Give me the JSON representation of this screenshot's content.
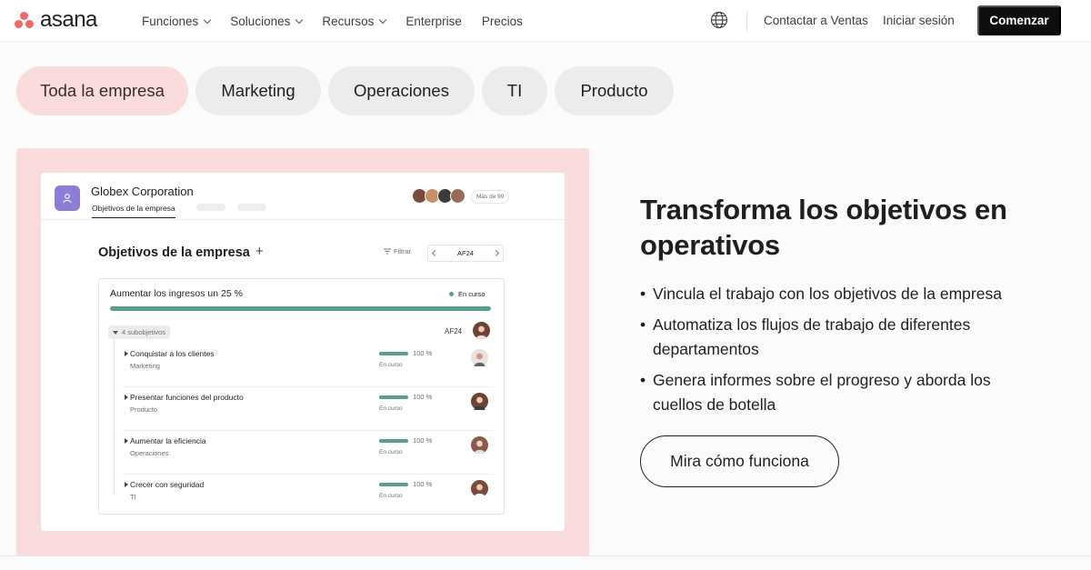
{
  "brand": {
    "name": "asana",
    "accent": "#f06a6a"
  },
  "nav": {
    "menu": [
      {
        "label": "Funciones",
        "dropdown": true
      },
      {
        "label": "Soluciones",
        "dropdown": true
      },
      {
        "label": "Recursos",
        "dropdown": true
      },
      {
        "label": "Enterprise",
        "dropdown": false
      },
      {
        "label": "Precios",
        "dropdown": false
      }
    ],
    "globe_icon": "globe-icon",
    "contact": "Contactar a Ventas",
    "login": "Iniciar sesión",
    "cta": "Comenzar"
  },
  "tabs": [
    {
      "label": "Toda la empresa",
      "active": true
    },
    {
      "label": "Marketing",
      "active": false
    },
    {
      "label": "Operaciones",
      "active": false
    },
    {
      "label": "TI",
      "active": false
    },
    {
      "label": "Producto",
      "active": false
    }
  ],
  "preview": {
    "org_name": "Globex Corporation",
    "org_tab": "Objetivos de la empresa",
    "more_members": "Más de 99",
    "title": "Objetivos de la empresa",
    "filter": "Filtrar",
    "period": "AF24",
    "goal": {
      "name": "Aumentar los ingresos un 25 %",
      "status": "En curso",
      "progress": 1.0,
      "subgoals_label": "4 subobjetivos",
      "period": "AF24"
    },
    "subgoals": [
      {
        "title": "Conquistar a los clientes",
        "team": "Marketing",
        "progress": 1.0,
        "pct": "100 %",
        "status": "En curso"
      },
      {
        "title": "Presentar funciones del producto",
        "team": "Producto",
        "progress": 1.0,
        "pct": "100 %",
        "status": "En curso"
      },
      {
        "title": "Aumentar la eficiencia",
        "team": "Operaciones",
        "progress": 1.0,
        "pct": "100 %",
        "status": "En curso"
      },
      {
        "title": "Crecer con seguridad",
        "team": "TI",
        "progress": 1.0,
        "pct": "100 %",
        "status": "En curso"
      }
    ],
    "status_color": "#58a182"
  },
  "hero": {
    "title": "Transforma los objetivos en operativos",
    "bullets": [
      "Vincula el trabajo con los objetivos de la empresa",
      "Automatiza los flujos de trabajo de diferentes departamentos",
      "Genera informes sobre el progreso y aborda los cuellos de botella"
    ],
    "button": "Mira cómo funciona"
  }
}
